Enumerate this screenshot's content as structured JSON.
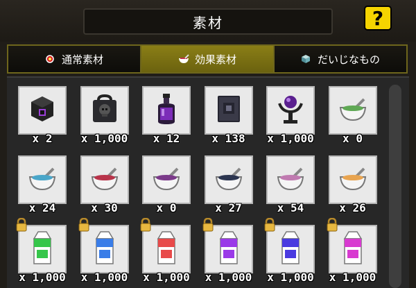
{
  "header": {
    "title": "素材",
    "help_label": "?"
  },
  "tabs": [
    {
      "label": "通常素材",
      "icon": "red-gem-icon",
      "active": false
    },
    {
      "label": "効果素材",
      "icon": "bowl-icon",
      "active": true
    },
    {
      "label": "だいじなもの",
      "icon": "cube-icon",
      "active": false
    }
  ],
  "items": [
    {
      "icon": "dark-cube-icon",
      "qty": "x 2"
    },
    {
      "icon": "skull-bag-icon",
      "qty": "x 1,000"
    },
    {
      "icon": "potion-bottle-icon",
      "qty": "x 12"
    },
    {
      "icon": "dark-book-icon",
      "qty": "x 138"
    },
    {
      "icon": "orb-stand-icon",
      "qty": "x 1,000"
    },
    {
      "icon": "green-bowl-icon",
      "qty": "x 0"
    },
    {
      "icon": "cyan-bowl-icon",
      "qty": "x 24"
    },
    {
      "icon": "red-bowl-icon",
      "qty": "x 30"
    },
    {
      "icon": "purple-bowl-icon",
      "qty": "x 0"
    },
    {
      "icon": "navy-bowl-icon",
      "qty": "x 27"
    },
    {
      "icon": "pink-bowl-icon",
      "qty": "x 54"
    },
    {
      "icon": "orange-bowl-icon",
      "qty": "x 26"
    },
    {
      "icon": "green-milk-carton-icon",
      "qty": "x 1,000",
      "locked": true
    },
    {
      "icon": "blue-milk-carton-icon",
      "qty": "x 1,000",
      "locked": true
    },
    {
      "icon": "red-milk-carton-icon",
      "qty": "x 1,000",
      "locked": true
    },
    {
      "icon": "purple-milk-carton-icon",
      "qty": "x 1,000",
      "locked": true
    },
    {
      "icon": "indigo-milk-carton-icon",
      "qty": "x 1,000",
      "locked": true
    },
    {
      "icon": "magenta-milk-carton-icon",
      "qty": "x 1,000",
      "locked": true
    }
  ],
  "colors": {
    "active_tab": "#7d7213",
    "help_button": "#f5d400",
    "bowl_fill": [
      "#5fa854",
      "#4aa6c9",
      "#b8344a",
      "#7b3a8a",
      "#2c3550",
      "#c07ab0",
      "#e8a450"
    ],
    "carton_fill": [
      "#35c64a",
      "#3a7de8",
      "#e84a4a",
      "#9a3ae8",
      "#4a3ae0",
      "#d83ad0"
    ]
  }
}
